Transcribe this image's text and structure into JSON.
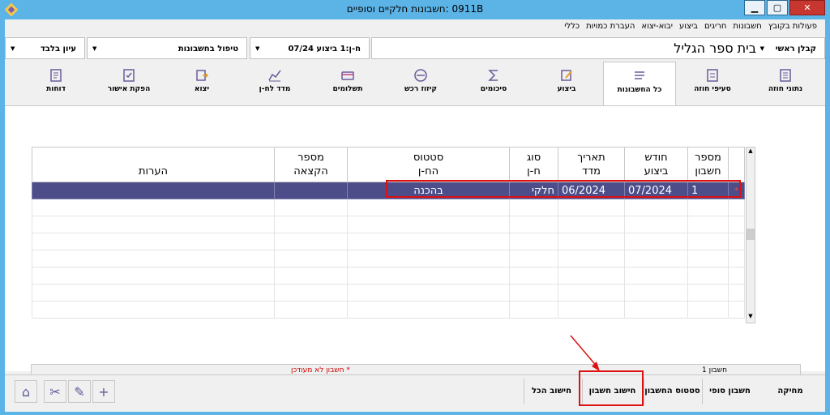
{
  "window": {
    "title": "0911B :חשבונות חלקיים וסופיים"
  },
  "menu": [
    "פעולות בקובץ",
    "חשבונות",
    "חריגים",
    "ביצוע",
    "יבוא-יצוא",
    "העברת כמויות",
    "כללי"
  ],
  "top": {
    "contractor_label": "קבלן ראשי",
    "project": "בית ספר הגליל",
    "account_selector": "ח-ן:1 ביצוע 07/24",
    "handling": "טיפול בחשבונות",
    "view": "עיון בלבד"
  },
  "tabs": [
    {
      "label": "נתוני חוזה",
      "icon": "contract-data-icon"
    },
    {
      "label": "סעיפי חוזה",
      "icon": "contract-items-icon"
    },
    {
      "label": "כל החשבונות",
      "icon": "all-accounts-icon"
    },
    {
      "label": "ביצוע",
      "icon": "execution-icon"
    },
    {
      "label": "סיכומים",
      "icon": "sigma-icon"
    },
    {
      "label": "קיזוז רכש",
      "icon": "purchase-offset-icon"
    },
    {
      "label": "תשלומים",
      "icon": "payments-icon"
    },
    {
      "label": "מדד לח-ן",
      "icon": "index-chart-icon"
    },
    {
      "label": "יצוא",
      "icon": "export-icon"
    },
    {
      "label": "הפקת אישור",
      "icon": "approval-icon"
    },
    {
      "label": "דוחות",
      "icon": "reports-icon"
    }
  ],
  "table": {
    "headers": [
      {
        "l1": "מספר",
        "l2": "חשבון"
      },
      {
        "l1": "חודש",
        "l2": "ביצוע"
      },
      {
        "l1": "תאריך",
        "l2": "מדד"
      },
      {
        "l1": "סוג",
        "l2": "ח-ן"
      },
      {
        "l1": "סטטוס",
        "l2": "הח-ן"
      },
      {
        "l1": "מספר",
        "l2": "הקצאה"
      },
      {
        "l1": "",
        "l2": "הערות"
      }
    ],
    "rows": [
      {
        "marker": "*",
        "num": "1",
        "month": "07/2024",
        "index_date": "06/2024",
        "type": "חלקי",
        "status": "בהכנה",
        "alloc": "",
        "notes": ""
      }
    ]
  },
  "status": {
    "count": "חשבון 1",
    "note": "* חשבון לא מעודכן"
  },
  "bottom": {
    "delete": "מחיקה",
    "final_account": "חשבון סופי",
    "account_status": "סטטוס החשבון",
    "calc_account": "חישוב חשבון",
    "calc_all": "חישוב הכל"
  }
}
